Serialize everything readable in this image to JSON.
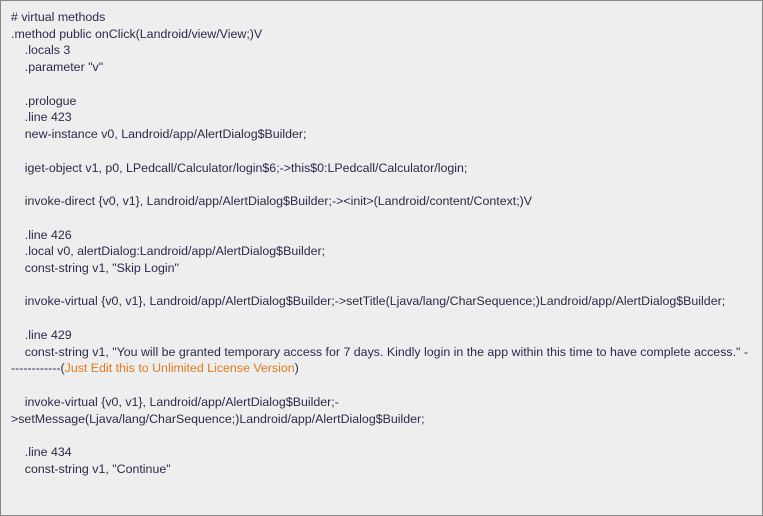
{
  "code": {
    "l01": "# virtual methods",
    "l02": ".method public onClick(Landroid/view/View;)V",
    "l03": "    .locals 3",
    "l04": "    .parameter \"v\"",
    "l05": "",
    "l06": "    .prologue",
    "l07": "    .line 423",
    "l08": "    new-instance v0, Landroid/app/AlertDialog$Builder;",
    "l09": "",
    "l10": "    iget-object v1, p0, LPedcall/Calculator/login$6;->this$0:LPedcall/Calculator/login;",
    "l11": "",
    "l12": "    invoke-direct {v0, v1}, Landroid/app/AlertDialog$Builder;-><init>(Landroid/content/Context;)V",
    "l13": "",
    "l14": "    .line 426",
    "l15": "    .local v0, alertDialog:Landroid/app/AlertDialog$Builder;",
    "l16": "    const-string v1, \"Skip Login\"",
    "l17": "",
    "l18": "    invoke-virtual {v0, v1}, Landroid/app/AlertDialog$Builder;->setTitle(Ljava/lang/CharSequence;)Landroid/app/AlertDialog$Builder;",
    "l19": "",
    "l20": "    .line 429",
    "l21": "    const-string v1, \"You will be granted temporary access for 7 days. Kindly login in the app within this time to have complete access.\" -------------(",
    "l22_hl": "Just Edit this to Unlimited License Version",
    "l22b": ")",
    "l23": "",
    "l24": "    invoke-virtual {v0, v1}, Landroid/app/AlertDialog$Builder;->setMessage(Ljava/lang/CharSequence;)Landroid/app/AlertDialog$Builder;",
    "l25": "",
    "l26": "    .line 434",
    "l27": "    const-string v1, \"Continue\""
  }
}
